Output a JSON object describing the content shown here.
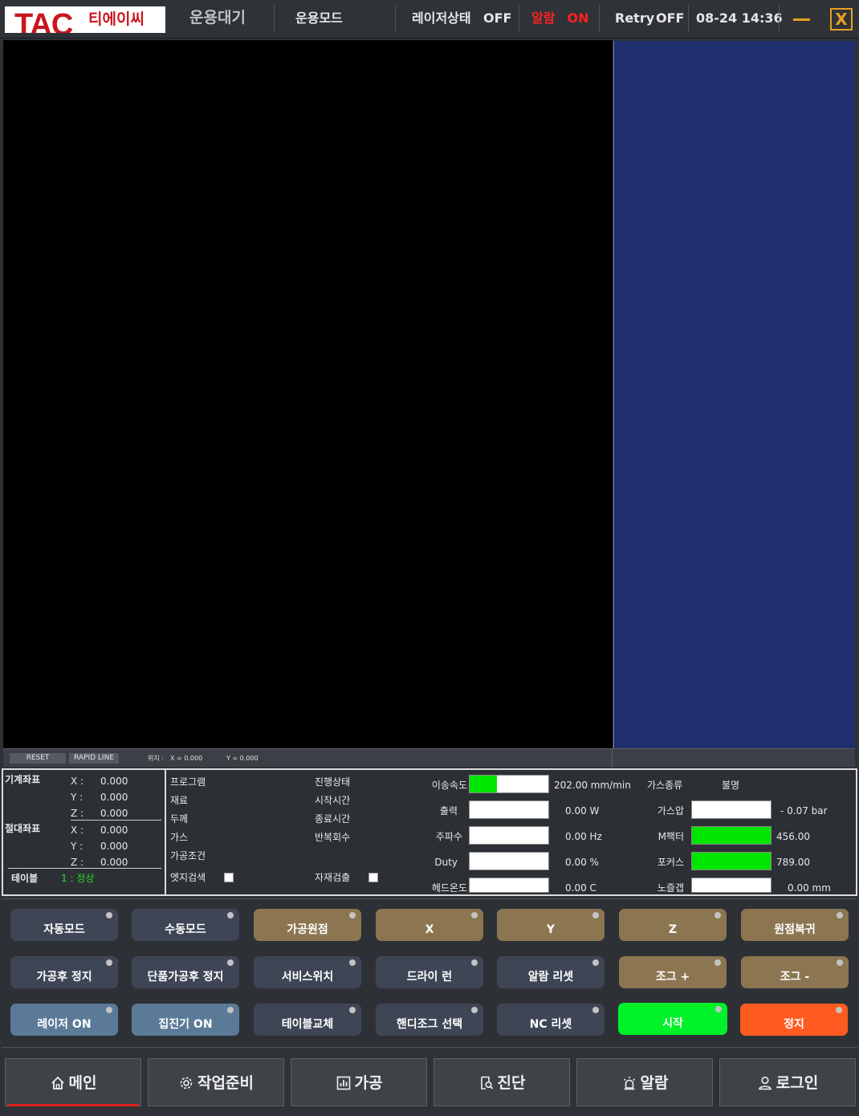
{
  "header": {
    "logo_text": "TAC",
    "logo_korean": "티에이씨",
    "operation_status": "운용대기",
    "operation_mode": "운용모드",
    "laser_status_label": "레이저상태",
    "laser_status_value": "OFF",
    "alarm_label": "알람",
    "alarm_value": "ON",
    "retry_label": "Retry",
    "retry_value": "OFF",
    "datetime": "08-24 14:36",
    "close_label": "X"
  },
  "strip": {
    "reset_label": "RESET",
    "rapid_line_label": "RAPID LINE",
    "position_label": "위치 :",
    "x_pos": "X = 0.000",
    "y_pos": "Y = 0.000"
  },
  "coords": {
    "machine_label": "기계좌표",
    "absolute_label": "절대좌표",
    "x_label": "X :",
    "y_label": "Y :",
    "z_label": "Z :",
    "machine": {
      "x": "0.000",
      "y": "0.000",
      "z": "0.000"
    },
    "absolute": {
      "x": "0.000",
      "y": "0.000",
      "z": "0.000"
    },
    "table_label": "테이블",
    "table_value": "1 : 정상"
  },
  "job": {
    "program": "프로그램",
    "material": "재료",
    "thickness": "두께",
    "gas": "가스",
    "condition": "가공조건",
    "edge_search": "엣지검색",
    "progress": "진행상태",
    "start_time": "시작시간",
    "end_time": "종료시간",
    "repeat_count": "반복회수",
    "material_detect": "자재검출"
  },
  "gauges": {
    "feed": {
      "label": "이송속도",
      "value": "202.00 mm/min",
      "fill": 0.35
    },
    "output": {
      "label": "출력",
      "value": "0.00 W",
      "fill": 0
    },
    "frequency": {
      "label": "주파수",
      "value": "0.00 Hz",
      "fill": 0
    },
    "duty": {
      "label": "Duty",
      "value": "0.00 %",
      "fill": 0
    },
    "head_temp": {
      "label": "헤드온도",
      "value": "0.00 C",
      "fill": 0
    },
    "gas_type": {
      "label": "가스종류",
      "value": "불명"
    },
    "gas_pressure": {
      "label": "가스압",
      "value": "- 0.07 bar",
      "fill": 0
    },
    "m_factor": {
      "label": "M팩터",
      "value": "456.00",
      "fill": 1
    },
    "focus": {
      "label": "포커스",
      "value": "789.00",
      "fill": 1
    },
    "nozzle_gap": {
      "label": "노즐갭",
      "value": "0.00 mm",
      "fill": 0
    }
  },
  "buttons": {
    "row1": [
      "자동모드",
      "수동모드",
      "가공원점",
      "X",
      "Y",
      "Z",
      "원점복귀"
    ],
    "row2": [
      "가공후 정지",
      "단품가공후 정지",
      "서비스위치",
      "드라이 런",
      "알람 리셋",
      "조그 +",
      "조그 -"
    ],
    "row3": [
      "레이저 ON",
      "집진기 ON",
      "테이블교체",
      "핸디조그 선택",
      "NC 리셋",
      "시작",
      "정지"
    ]
  },
  "nav": {
    "main": "메인",
    "prep": "작업준비",
    "process": "가공",
    "diagnosis": "진단",
    "alarm": "알람",
    "login": "로그인"
  },
  "colors": {
    "accent_tan": "#8c7551",
    "button_gray": "#3e4555",
    "button_blue": "#5b7a97",
    "start_green": "#00f02a",
    "stop_orange": "#ff5a1f",
    "alarm_red": "#ff2020",
    "gauge_green": "#00e600",
    "side_panel_blue": "#1f2e6d"
  }
}
